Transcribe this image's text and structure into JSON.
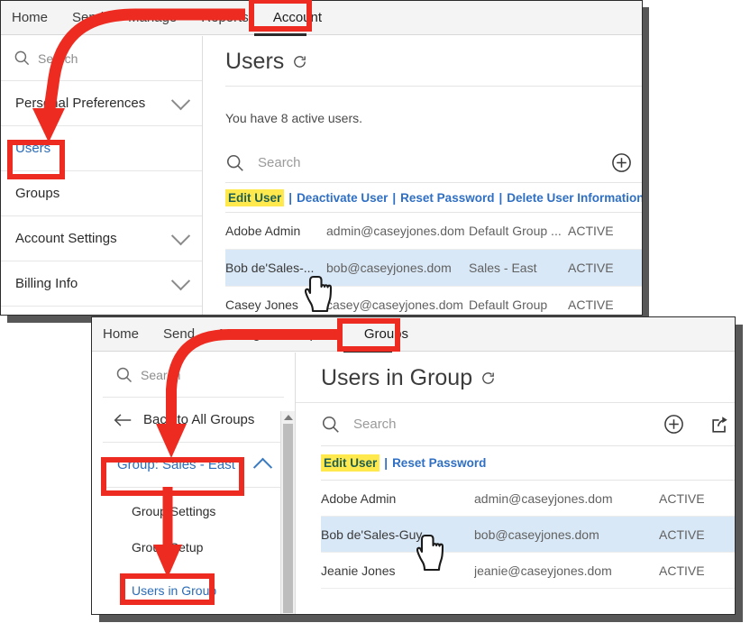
{
  "top_panel": {
    "navbar": {
      "items": [
        {
          "label": "Home",
          "active": false
        },
        {
          "label": "Send",
          "active": false
        },
        {
          "label": "Manage",
          "active": false
        },
        {
          "label": "Reports",
          "active": false
        },
        {
          "label": "Account",
          "active": true
        }
      ]
    },
    "sidebar": {
      "search_placeholder": "Search",
      "items": [
        {
          "label": "Personal Preferences",
          "expandable": true,
          "link": false
        },
        {
          "label": "Users",
          "expandable": false,
          "link": true
        },
        {
          "label": "Groups",
          "expandable": false,
          "link": false
        },
        {
          "label": "Account Settings",
          "expandable": true,
          "link": false
        },
        {
          "label": "Billing Info",
          "expandable": true,
          "link": false
        }
      ]
    },
    "main": {
      "title": "Users",
      "refresh_icon": "refresh-icon",
      "blurb": "You have 8 active users.",
      "search_placeholder": "Search",
      "add_icon": "plus-circle-icon",
      "actions": [
        {
          "label": "Edit User",
          "highlighted": true
        },
        {
          "label": "Deactivate User",
          "highlighted": false
        },
        {
          "label": "Reset Password",
          "highlighted": false
        },
        {
          "label": "Delete User Information",
          "highlighted": false
        }
      ],
      "action_separator": "|",
      "rows": [
        {
          "name": "Adobe Admin",
          "email": "admin@caseyjones.dom",
          "group": "Default Group ...",
          "status": "ACTIVE",
          "selected": false
        },
        {
          "name": "Bob de'Sales-...",
          "email": "bob@caseyjones.dom",
          "group": "Sales - East",
          "status": "ACTIVE",
          "selected": true
        },
        {
          "name": "Casey Jones",
          "email": "casey@caseyjones.dom",
          "group": "Default Group",
          "status": "ACTIVE",
          "selected": false
        }
      ]
    }
  },
  "bottom_panel": {
    "navbar": {
      "items": [
        {
          "label": "Home",
          "active": false
        },
        {
          "label": "Send",
          "active": false
        },
        {
          "label": "Manage",
          "active": false
        },
        {
          "label": "Reports",
          "active": false
        },
        {
          "label": "Groups",
          "active": true
        }
      ]
    },
    "sidebar": {
      "search_placeholder": "Search",
      "back_label": "Back to All Groups",
      "back_icon": "arrow-left-icon",
      "group_header": "Group: Sales - East",
      "sub_items": [
        {
          "label": "Group Settings",
          "link": false
        },
        {
          "label": "Group Setup",
          "link": false
        },
        {
          "label": "Users in Group",
          "link": true
        }
      ]
    },
    "main": {
      "title": "Users in Group",
      "refresh_icon": "refresh-icon",
      "search_placeholder": "Search",
      "add_icon": "plus-circle-icon",
      "export_icon": "export-share-icon",
      "actions": [
        {
          "label": "Edit User",
          "highlighted": true
        },
        {
          "label": "Reset Password",
          "highlighted": false
        }
      ],
      "action_separator": "|",
      "rows": [
        {
          "name": "Adobe Admin",
          "email": "admin@caseyjones.dom",
          "status": "ACTIVE",
          "selected": false
        },
        {
          "name": "Bob de'Sales-Guy",
          "email": "bob@caseyjones.dom",
          "status": "ACTIVE",
          "selected": true
        },
        {
          "name": "Jeanie Jones",
          "email": "jeanie@caseyjones.dom",
          "status": "ACTIVE",
          "selected": false
        }
      ]
    }
  },
  "annotations": {
    "color": "#ee2b20",
    "highlight_color": "#ffe94d",
    "boxes": [
      {
        "target": "Account"
      },
      {
        "target": "Users"
      },
      {
        "target": "Groups"
      },
      {
        "target": "Group: Sales - East"
      },
      {
        "target": "Users in Group"
      }
    ],
    "arrows": [
      {
        "from": "Account",
        "to": "Users"
      },
      {
        "from": "Groups",
        "to": "Group: Sales - East"
      },
      {
        "from": "Group: Sales - East",
        "to": "Users in Group"
      }
    ]
  }
}
